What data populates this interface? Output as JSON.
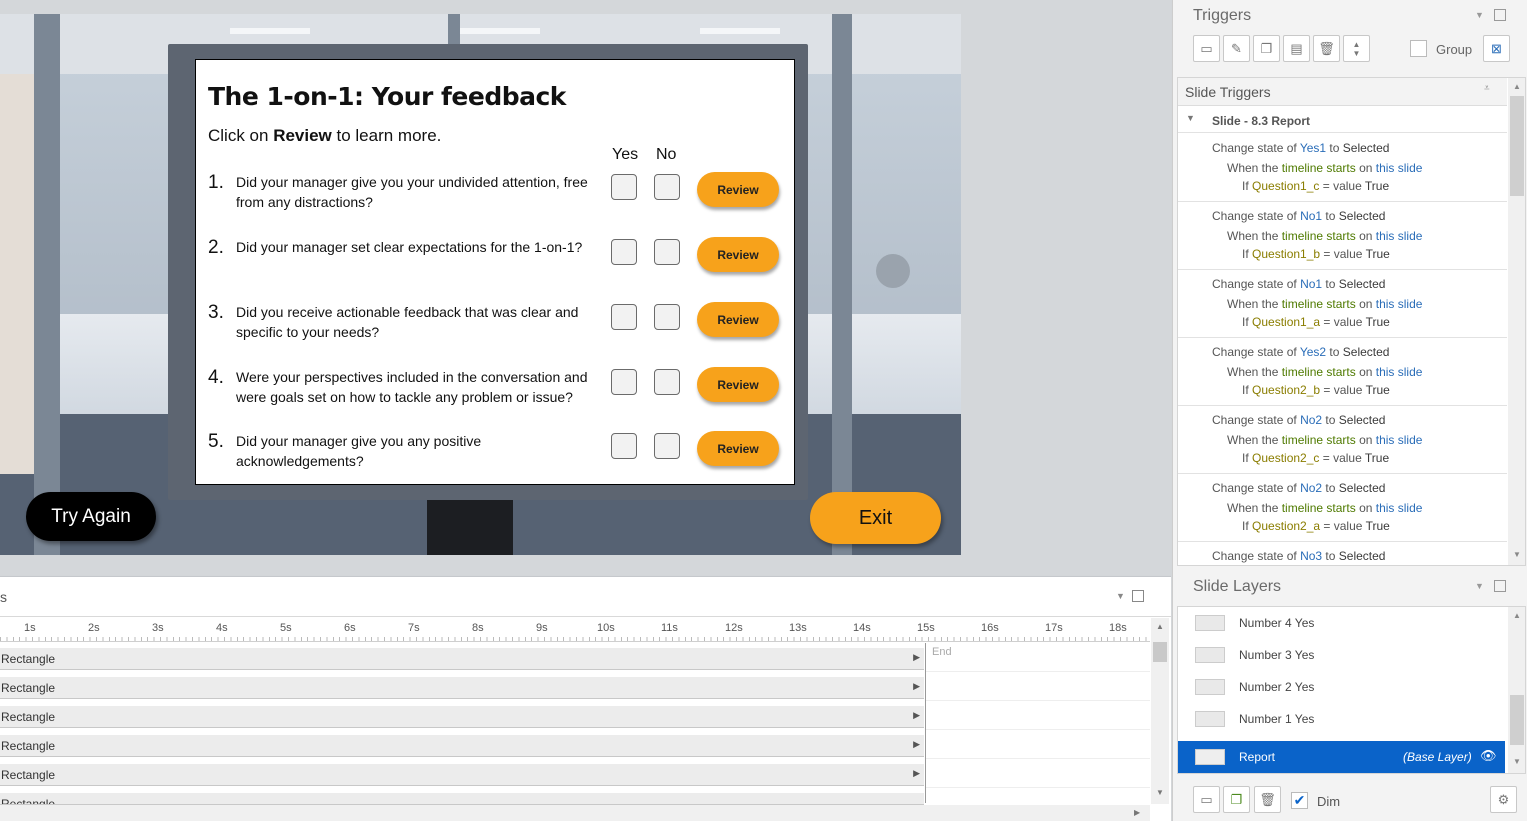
{
  "slide": {
    "title": "The 1-on-1: Your feedback",
    "subtitle_pre": "Click on ",
    "subtitle_bold": "Review",
    "subtitle_post": " to learn more.",
    "col_yes": "Yes",
    "col_no": "No",
    "questions": [
      {
        "num": "1.",
        "text": "Did your manager give you your undivided attention, free from any distractions?",
        "button": "Review"
      },
      {
        "num": "2.",
        "text": "Did your manager set clear expectations for the 1-on-1?",
        "button": "Review"
      },
      {
        "num": "3.",
        "text": "Did you receive actionable feedback that was clear and specific to your needs?",
        "button": "Review"
      },
      {
        "num": "4.",
        "text": "Were your perspectives included in the conversation and were goals set on how to tackle any problem or issue?",
        "button": "Review"
      },
      {
        "num": "5.",
        "text": "Did your manager give you any positive acknowledgements?",
        "button": "Review"
      }
    ],
    "try_again": "Try Again",
    "exit": "Exit"
  },
  "timeline": {
    "title_fragment": "s",
    "ticks": [
      "1s",
      "2s",
      "3s",
      "4s",
      "5s",
      "6s",
      "7s",
      "8s",
      "9s",
      "10s",
      "11s",
      "12s",
      "13s",
      "14s",
      "15s",
      "16s",
      "17s",
      "18s"
    ],
    "end_label": "End",
    "rows": [
      "Rectangle",
      "Rectangle",
      "Rectangle",
      "Rectangle",
      "Rectangle",
      "Rectangle"
    ]
  },
  "triggers_panel": {
    "title": "Triggers",
    "group_label": "Group",
    "slide_triggers_label": "Slide Triggers",
    "slide_name": "Slide - 8.3 Report",
    "triggers": [
      {
        "obj": "Yes1",
        "var": "Question1_c"
      },
      {
        "obj": "No1",
        "var": "Question1_b"
      },
      {
        "obj": "No1",
        "var": "Question1_a"
      },
      {
        "obj": "Yes2",
        "var": "Question2_b"
      },
      {
        "obj": "No2",
        "var": "Question2_c"
      },
      {
        "obj": "No2",
        "var": "Question2_a"
      },
      {
        "obj": "No3",
        "var": ""
      }
    ],
    "t_change": "Change state of ",
    "t_to": " to ",
    "t_selected": "Selected",
    "t_when": "When the ",
    "t_timeline": "timeline starts",
    "t_on": " on ",
    "t_thisslide": "this slide",
    "t_if": "If ",
    "t_eq": " = value ",
    "t_true": "True"
  },
  "layers_panel": {
    "title": "Slide Layers",
    "layers": [
      "Number 4 Yes",
      "Number 3 Yes",
      "Number 2 Yes",
      "Number 1 Yes"
    ],
    "base_name": "Report",
    "base_tag": "(Base Layer)",
    "dim_label": "Dim"
  },
  "colors": {
    "accent": "#f7a21b",
    "selection": "#0a63c9"
  }
}
